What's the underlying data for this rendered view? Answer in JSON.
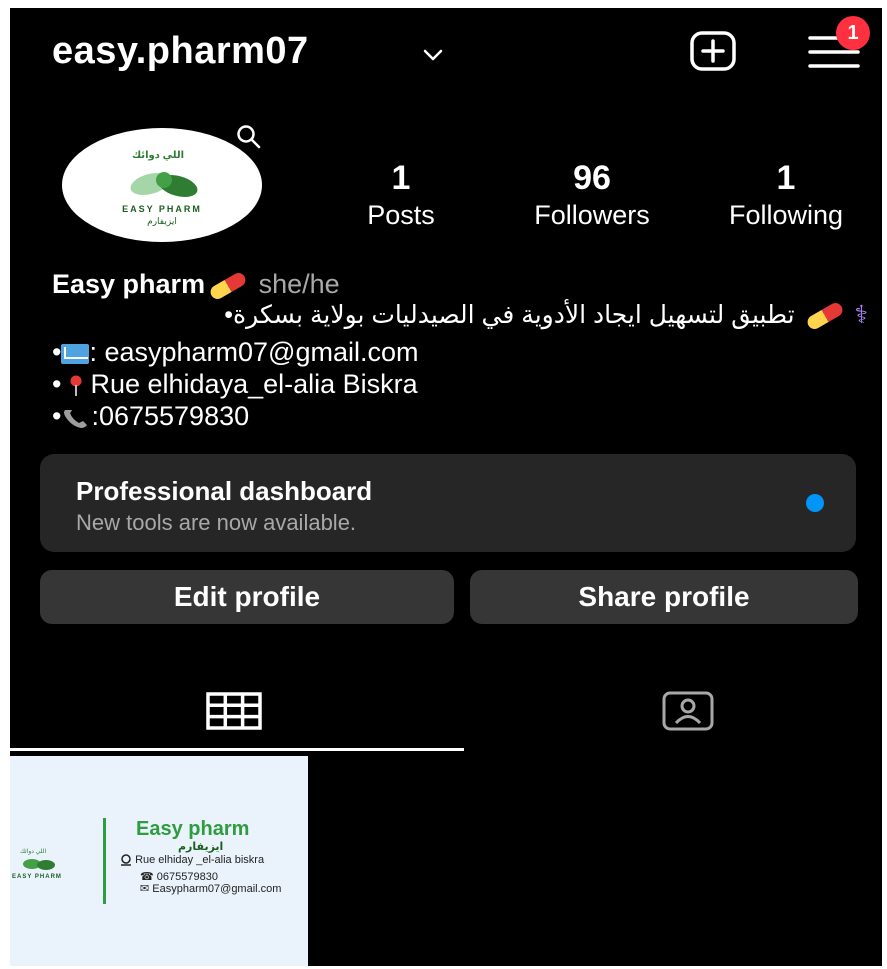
{
  "header": {
    "username": "easy.pharm07",
    "notification_count": "1",
    "accent_red": "#ff3040"
  },
  "avatar": {
    "top_text": "اللي دوائك",
    "brand": "EASY PHARM",
    "sub": "ايزيفارم"
  },
  "stats": [
    {
      "value": "1",
      "label": "Posts"
    },
    {
      "value": "96",
      "label": "Followers"
    },
    {
      "value": "1",
      "label": "Following"
    }
  ],
  "bio": {
    "name": "Easy pharm",
    "pronouns": "she/he",
    "arabic_line": "تطبيق لتسهيل ايجاد الأدوية في الصيدليات بولاية بسكرة•",
    "email_line": ": easypharm07@gmail.com",
    "address_line": "Rue elhidaya_el-alia Biskra",
    "phone_line": ":0675579830"
  },
  "dashboard": {
    "title": "Professional dashboard",
    "subtitle": "New tools are now available.",
    "dot_color": "#0095f6"
  },
  "buttons": {
    "edit": "Edit profile",
    "share": "Share profile"
  },
  "tabs": {
    "active": "grid",
    "icons": [
      "grid-icon",
      "tagged-icon"
    ]
  },
  "post": {
    "title": "Easy pharm",
    "subtitle": "ايزيفارم",
    "address": "Rue elhiday _el-alia biskra",
    "phone": "0675579830",
    "email": "Easypharm07@gmail.com",
    "logo_top": "اللي دوائك",
    "logo_brand": "EASY PHARM",
    "accent_green": "#2e9c3f"
  }
}
